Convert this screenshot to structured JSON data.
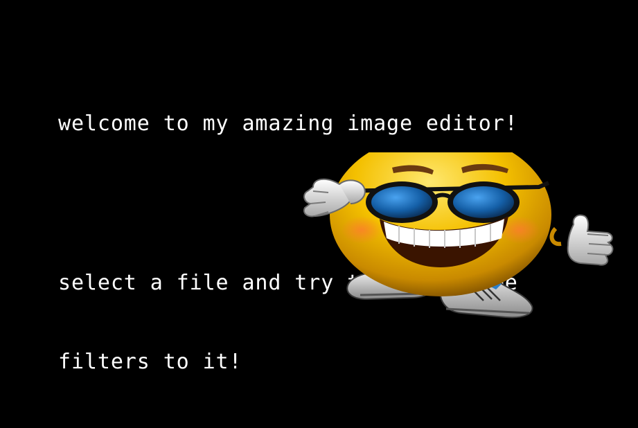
{
  "app": {
    "title": "amazing image editor"
  },
  "welcome": {
    "line1": "welcome to my amazing image editor!",
    "line2": "select a file and try to apply some",
    "line3": "filters to it!"
  },
  "mascot": {
    "icon": "cool-smiley-thumbs-up-icon"
  },
  "colors": {
    "background": "#000000",
    "text": "#ffffff",
    "face": "#f2c200",
    "lens": "#1e6fb8"
  }
}
